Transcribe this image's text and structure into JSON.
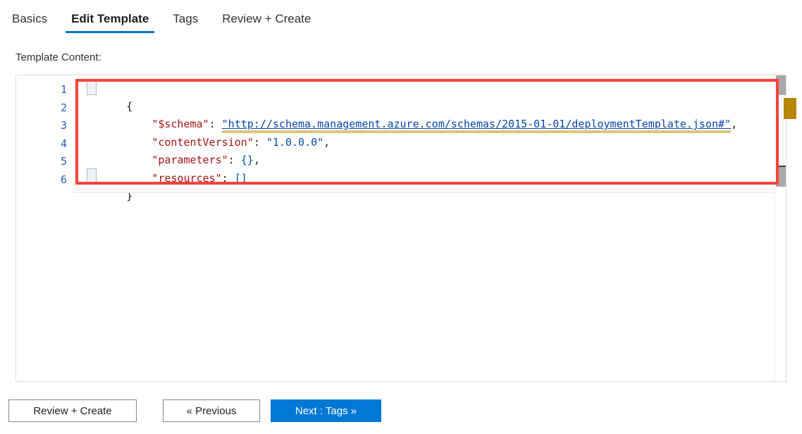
{
  "tabs": [
    {
      "label": "Basics",
      "active": false
    },
    {
      "label": "Edit Template",
      "active": true
    },
    {
      "label": "Tags",
      "active": false
    },
    {
      "label": "Review + Create",
      "active": false
    }
  ],
  "content_label": "Template Content:",
  "editor": {
    "language": "json",
    "line_numbers": [
      "1",
      "2",
      "3",
      "4",
      "5",
      "6"
    ],
    "lines": [
      {
        "n": "1",
        "text": "{"
      },
      {
        "n": "2",
        "text": "    \"$schema\": \"http://schema.management.azure.com/schemas/2015-01-01/deploymentTemplate.json#\","
      },
      {
        "n": "3",
        "text": "    \"contentVersion\": \"1.0.0.0\","
      },
      {
        "n": "4",
        "text": "    \"parameters\": {},"
      },
      {
        "n": "5",
        "text": "    \"resources\": []"
      },
      {
        "n": "6",
        "text": "}"
      }
    ],
    "tokens": {
      "schema_key": "\"$schema\"",
      "schema_url": "\"http://schema.management.azure.com/schemas/2015-01-01/deploymentTemplate.json#\"",
      "content_version_key": "\"contentVersion\"",
      "content_version_value": "\"1.0.0.0\"",
      "parameters_key": "\"parameters\"",
      "parameters_value": "{}",
      "resources_key": "\"resources\"",
      "resources_value": "[]",
      "open_brace": "{",
      "close_brace": "}",
      "colon": ":",
      "comma": ","
    }
  },
  "footer": {
    "review_create_label": "Review + Create",
    "previous_label": "« Previous",
    "next_label": "Next : Tags »"
  },
  "colors": {
    "accent": "#0078d4",
    "annotation": "#f4433a",
    "key": "#a31515",
    "string": "#0451a5",
    "link": "#0645ad",
    "warning": "#b8860b",
    "line_number": "#2b5eb8"
  }
}
